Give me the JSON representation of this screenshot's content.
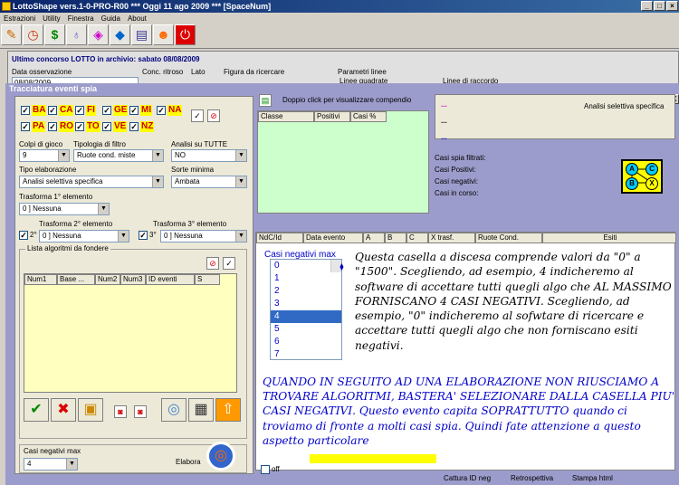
{
  "titlebar": {
    "title": "LottoShape vers.1-0-PRO-R00   ***   Oggi 11 ago 2009   ***   [SpaceNum]"
  },
  "menu": [
    "Estrazioni",
    "Utility",
    "Finestra",
    "Guida",
    "About"
  ],
  "toolbar": {
    "icons": [
      "pencil-icon",
      "clock-icon",
      "dollar-icon",
      "bulb-icon",
      "dice-icon",
      "shape-icon",
      "notes-icon",
      "people-icon",
      "power-icon"
    ]
  },
  "background": {
    "header": "Ultimo concorso LOTTO in archivio: sabato 08/08/2009",
    "labels": [
      "Data osservazione",
      "Conc. ritroso",
      "Lato",
      "Figura da ricercare",
      "Parametri linee",
      "Linee quadrate",
      "Linee di raccordo"
    ],
    "date_value": "08/08/2009"
  },
  "dialog": {
    "title": "Tracciatura eventi spia",
    "cities": [
      {
        "name": "BA",
        "checked": true
      },
      {
        "name": "CA",
        "checked": true
      },
      {
        "name": "FI",
        "checked": true
      },
      {
        "name": "GE",
        "checked": true
      },
      {
        "name": "MI",
        "checked": true
      },
      {
        "name": "NA",
        "checked": true
      },
      {
        "name": "PA",
        "checked": true
      },
      {
        "name": "RO",
        "checked": true
      },
      {
        "name": "TO",
        "checked": true
      },
      {
        "name": "VE",
        "checked": true
      },
      {
        "name": "NZ",
        "checked": true
      }
    ],
    "colpi_label": "Colpi di gioco",
    "colpi_value": "9",
    "tipologia_label": "Tipologia di filtro",
    "tipologia_value": "Ruote cond. miste",
    "analisi_label": "Analisi su TUTTE",
    "analisi_value": "NO",
    "tipo_elab_label": "Tipo elaborazione",
    "tipo_elab_value": "Analisi selettiva specifica",
    "sorte_label": "Sorte minima",
    "sorte_value": "Ambata",
    "trasf1_label": "Trasforma 1° elemento",
    "trasf1_value": "0 ] Nessuna",
    "trasf2_label": "Trasforma 2° elemento",
    "trasf2_chk": "2°",
    "trasf2_value": "0 ] Nessuna",
    "trasf3_label": "Trasforma 3° elemento",
    "trasf3_chk": "3°",
    "trasf3_value": "0 ] Nessuna",
    "lista_label": "Lista algoritmi da fondere",
    "lista_cols": [
      "Num1",
      "Base ...",
      "Num2",
      "Num3",
      "ID eventi",
      "S"
    ],
    "casi_neg_label": "Casi negativi max",
    "casi_neg_value": "4",
    "elabora_label": "Elabora",
    "compendio_label": "Doppio click per visualizzare compendio",
    "green_cols": [
      "Classe",
      "Positivi",
      "Casi %"
    ],
    "panel_title": "Analisi selettiva specifica",
    "dots": [
      "...",
      "...",
      "..."
    ],
    "info": [
      "Casi spia filtrati:",
      "Casi Positivi:",
      "Casi negativi:",
      "Casi in corso:"
    ],
    "circles": [
      "A",
      "C",
      "B",
      "X"
    ],
    "right_cols": [
      "NdC/Id",
      "Data evento",
      "A",
      "B",
      "C",
      "X trasf.",
      "Ruote Cond.",
      "Esiti"
    ],
    "neg_label": "Casi negativi max",
    "neg_options": [
      "0",
      "1",
      "2",
      "3",
      "4",
      "5",
      "6",
      "7"
    ],
    "neg_selected": "4",
    "note1": "Questa casella a discesa comprende valori da \"0\" a \"1500\". Scegliendo, ad esempio, 4 indicheremo al software di accettare tutti quegli algo che AL MASSIMO FORNISCANO 4 CASI NEGATIVI. Scegliendo, ad esempio, \"0\" indicheremo al sofwtare di ricercare e accettare tutti quegli algo che non forniscano esiti negativi.",
    "note2": "QUANDO IN SEGUITO AD UNA ELABORAZIONE NON RIUSCIAMO A TROVARE ALGORITMI, BASTERA' SELEZIONARE DALLA CASELLA PIU' CASI NEGATIVI. Questo evento capita SOPRATTUTTO quando ci troviamo di fronte a molti casi spia. Quindi fate attenzione a questo aspetto particolare",
    "bottom_off": "off",
    "bottom_btns": [
      "Cattura ID neg",
      "Retrospettiva",
      "Stampa html"
    ]
  }
}
